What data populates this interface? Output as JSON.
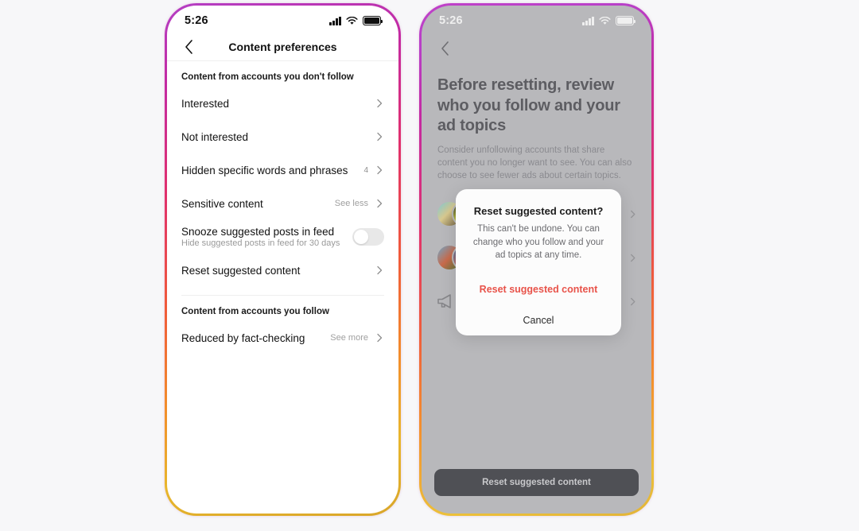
{
  "theme": {
    "page_bg": "#f7f7f9",
    "frame_gradient_start": "#b43fc4",
    "frame_gradient_mid": "#e1306c",
    "frame_gradient_end": "#e8b62c",
    "danger_color": "#e8534a",
    "cta_bg": "#4f5055",
    "dim_overlay_bg": "#b8b8bb"
  },
  "left_phone": {
    "status": {
      "time": "5:26",
      "signal_icon": "cellular-signal-icon",
      "wifi_icon": "wifi-icon",
      "battery_icon": "battery-full-icon"
    },
    "nav": {
      "back_icon": "chevron-left-icon",
      "title": "Content preferences"
    },
    "sections": [
      {
        "header": "Content from accounts you don't follow",
        "rows": [
          {
            "label": "Interested",
            "sub": "",
            "value": "",
            "count": "",
            "type": "chevron"
          },
          {
            "label": "Not interested",
            "sub": "",
            "value": "",
            "count": "",
            "type": "chevron"
          },
          {
            "label": "Hidden specific words and phrases",
            "sub": "",
            "value": "",
            "count": "4",
            "type": "chevron"
          },
          {
            "label": "Sensitive content",
            "sub": "",
            "value": "See less",
            "count": "",
            "type": "chevron"
          },
          {
            "label": "Snooze suggested posts in feed",
            "sub": "Hide suggested posts in feed for 30 days",
            "value": "",
            "count": "",
            "type": "toggle",
            "toggle_on": false
          },
          {
            "label": "Reset suggested content",
            "sub": "",
            "value": "",
            "count": "",
            "type": "chevron"
          }
        ]
      },
      {
        "header": "Content from accounts you follow",
        "rows": [
          {
            "label": "Reduced by fact-checking",
            "sub": "",
            "value": "See more",
            "count": "",
            "type": "chevron"
          }
        ]
      }
    ]
  },
  "right_phone": {
    "status": {
      "time": "5:26",
      "signal_icon": "cellular-signal-icon",
      "wifi_icon": "wifi-icon",
      "battery_icon": "battery-full-icon"
    },
    "nav": {
      "back_icon": "chevron-left-icon"
    },
    "heading": "Before resetting, review who you follow and your ad topics",
    "subtitle": "Consider unfollowing accounts that share content you no longer want to see. You can also choose to see fewer ads about certain topics.",
    "rows": [
      {
        "type": "avatars",
        "icon": "",
        "chevron_icon": "chevron-right-icon"
      },
      {
        "type": "avatars",
        "icon": "",
        "chevron_icon": "chevron-right-icon"
      },
      {
        "type": "icon",
        "icon": "megaphone-icon",
        "chevron_icon": "chevron-right-icon"
      }
    ],
    "cta_label": "Reset suggested content",
    "modal": {
      "title": "Reset suggested content?",
      "message": "This can't be undone. You can change who you follow and your ad topics at any time.",
      "confirm_label": "Reset suggested content",
      "cancel_label": "Cancel"
    }
  }
}
